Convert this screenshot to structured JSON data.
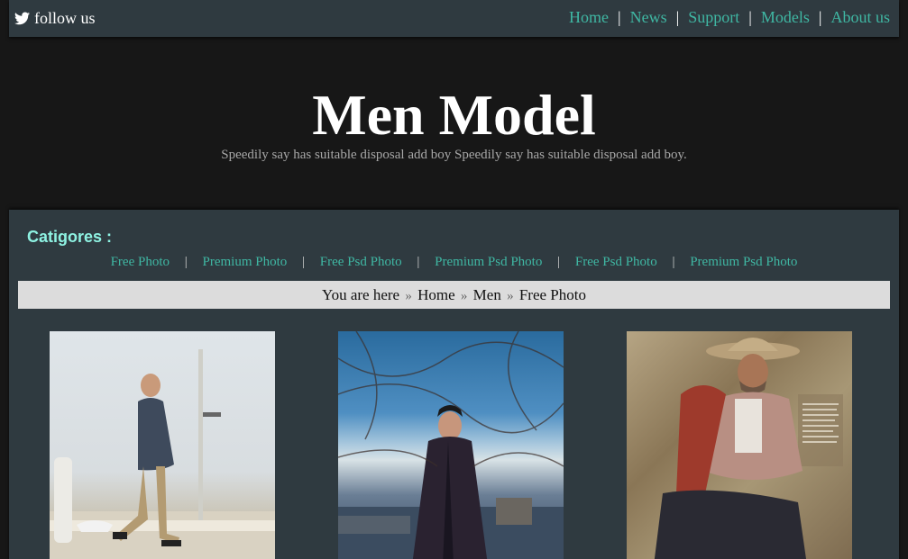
{
  "topbar": {
    "follow_label": "follow us",
    "nav": [
      {
        "label": "Home"
      },
      {
        "label": "News"
      },
      {
        "label": "Support"
      },
      {
        "label": "Models"
      },
      {
        "label": "About us"
      }
    ]
  },
  "header": {
    "title": "Men Model",
    "subtitle": "Speedily say has suitable disposal add boy Speedily say has suitable disposal add boy."
  },
  "categories": {
    "title": "Catigores :",
    "items": [
      {
        "label": "Free Photo"
      },
      {
        "label": "Premium Photo"
      },
      {
        "label": "Free Psd Photo"
      },
      {
        "label": "Premium Psd Photo"
      },
      {
        "label": "Free Psd Photo"
      },
      {
        "label": "Premium Psd Photo"
      }
    ]
  },
  "breadcrumb": {
    "prefix": "You are here",
    "items": [
      "Home",
      "Men",
      "Free Photo"
    ]
  },
  "colors": {
    "accent": "#3fb7a3",
    "panel": "#2f3a40",
    "background": "#171717",
    "category_title": "#8ef2e2"
  },
  "icons": {
    "follow": "twitter-bird-icon",
    "breadcrumb_separator": "double-chevron-right-icon"
  }
}
